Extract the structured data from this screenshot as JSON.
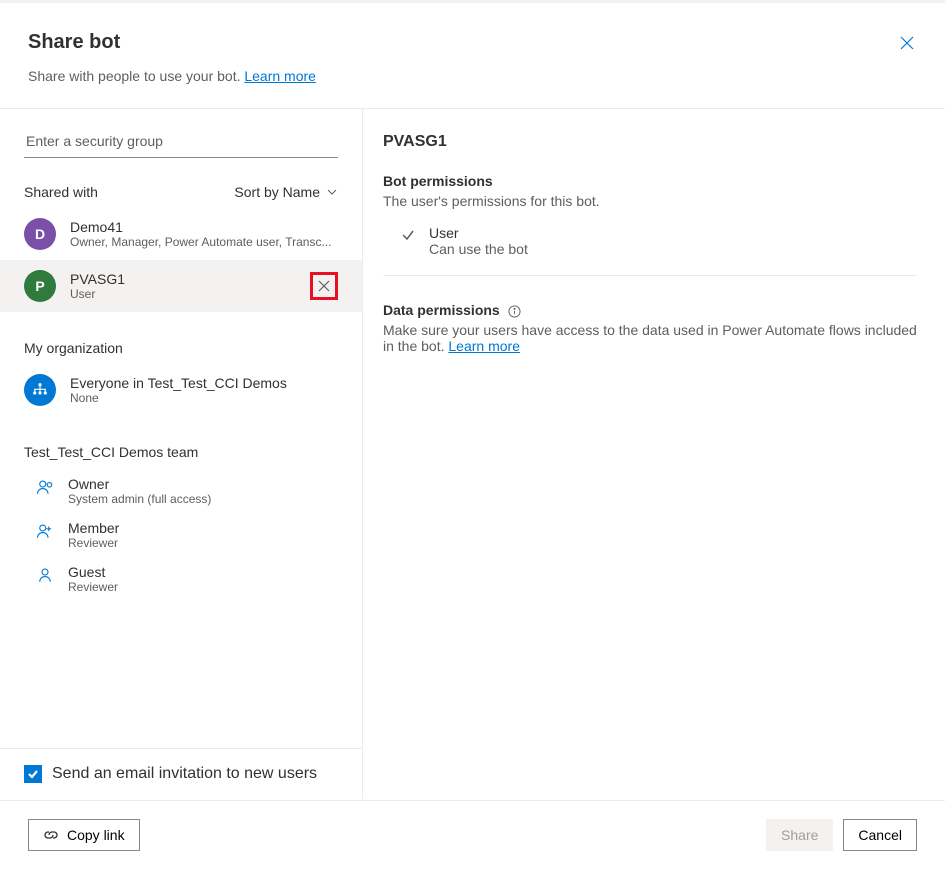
{
  "header": {
    "title": "Share bot",
    "subtitle_prefix": "Share with people to use your bot. ",
    "learn_more": "Learn more"
  },
  "left": {
    "search_placeholder": "Enter a security group",
    "shared_with_label": "Shared with",
    "sort_label": "Sort by Name",
    "items": [
      {
        "initial": "D",
        "name": "Demo41",
        "role": "Owner, Manager, Power Automate user, Transc..."
      },
      {
        "initial": "P",
        "name": "PVASG1",
        "role": "User"
      }
    ],
    "org_label": "My organization",
    "org_item": {
      "name": "Everyone in Test_Test_CCI Demos",
      "role": "None"
    },
    "team_label": "Test_Test_CCI Demos team",
    "roles": [
      {
        "name": "Owner",
        "desc": "System admin (full access)"
      },
      {
        "name": "Member",
        "desc": "Reviewer"
      },
      {
        "name": "Guest",
        "desc": "Reviewer"
      }
    ],
    "email_checkbox_label": "Send an email invitation to new users"
  },
  "right": {
    "title": "PVASG1",
    "bot_perm_heading": "Bot permissions",
    "bot_perm_desc": "The user's permissions for this bot.",
    "perm_name": "User",
    "perm_desc": "Can use the bot",
    "data_perm_heading": "Data permissions",
    "data_perm_text_prefix": "Make sure your users have access to the data used in Power Automate flows included in the bot. ",
    "data_perm_learn": "Learn more"
  },
  "footer": {
    "copy_link": "Copy link",
    "share": "Share",
    "cancel": "Cancel"
  }
}
